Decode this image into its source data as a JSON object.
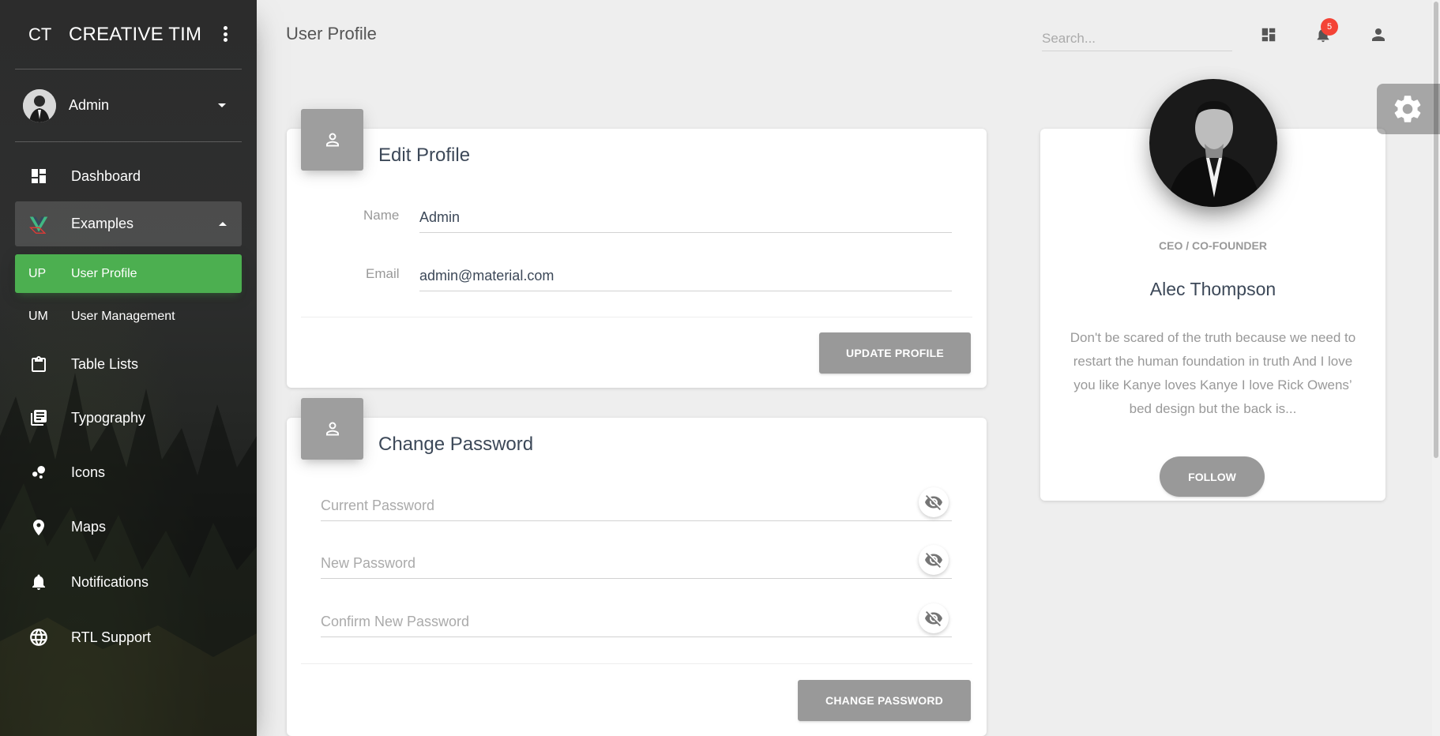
{
  "sidebar": {
    "logo_mini": "CT",
    "logo_full": "CREATIVE TIM",
    "user_name": "Admin",
    "items": [
      {
        "label": "Dashboard",
        "icon": "dashboard-icon"
      },
      {
        "label": "Examples",
        "icon": "vue-logo-icon"
      },
      {
        "abbr": "UP",
        "label": "User Profile"
      },
      {
        "abbr": "UM",
        "label": "User Management"
      },
      {
        "label": "Table Lists",
        "icon": "clipboard-icon"
      },
      {
        "label": "Typography",
        "icon": "library-books-icon"
      },
      {
        "label": "Icons",
        "icon": "bubble-chart-icon"
      },
      {
        "label": "Maps",
        "icon": "place-icon"
      },
      {
        "label": "Notifications",
        "icon": "bell-icon"
      },
      {
        "label": "RTL Support",
        "icon": "language-icon"
      }
    ]
  },
  "topbar": {
    "title": "User Profile",
    "search_placeholder": "Search...",
    "notification_count": "5"
  },
  "edit_profile": {
    "title": "Edit Profile",
    "name_label": "Name",
    "name_value": "Admin",
    "email_label": "Email",
    "email_value": "admin@material.com",
    "button": "UPDATE PROFILE"
  },
  "change_password": {
    "title": "Change Password",
    "current_placeholder": "Current Password",
    "new_placeholder": "New Password",
    "confirm_placeholder": "Confirm New Password",
    "button": "CHANGE PASSWORD"
  },
  "profile_card": {
    "role": "CEO / CO-FOUNDER",
    "name": "Alec Thompson",
    "bio": "Don't be scared of the truth because we need to restart the human foundation in truth And I love you like Kanye loves Kanye I love Rick Owens’ bed design but the back is...",
    "button": "FOLLOW"
  },
  "colors": {
    "active": "#4caf50",
    "badge": "#f44336",
    "button": "#999999"
  }
}
